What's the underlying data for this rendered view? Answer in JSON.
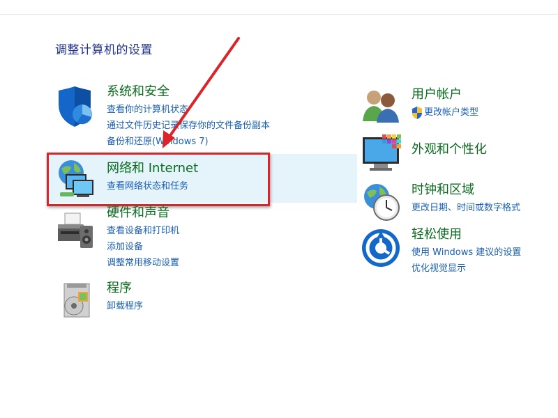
{
  "page": {
    "title": "调整计算机的设置"
  },
  "categories_left": [
    {
      "title": "系统和安全",
      "links": [
        "查看你的计算机状态",
        "通过文件历史记录保存你的文件备份副本",
        "备份和还原(Windows 7)"
      ]
    },
    {
      "title": "网络和 Internet",
      "links": [
        "查看网络状态和任务"
      ]
    },
    {
      "title": "硬件和声音",
      "links": [
        "查看设备和打印机",
        "添加设备",
        "调整常用移动设置"
      ]
    },
    {
      "title": "程序",
      "links": [
        "卸载程序"
      ]
    }
  ],
  "categories_right": [
    {
      "title": "用户帐户",
      "links": [
        "更改帐户类型"
      ]
    },
    {
      "title": "外观和个性化",
      "links": []
    },
    {
      "title": "时钟和区域",
      "links": [
        "更改日期、时间或数字格式"
      ]
    },
    {
      "title": "轻松使用",
      "links": [
        "使用 Windows 建议的设置",
        "优化视觉显示"
      ]
    }
  ],
  "colors": {
    "title_green": "#0b6b1f",
    "link_blue": "#1a5fb4",
    "highlight_red": "#d9252a",
    "highlight_bg": "#e5f3fb"
  }
}
